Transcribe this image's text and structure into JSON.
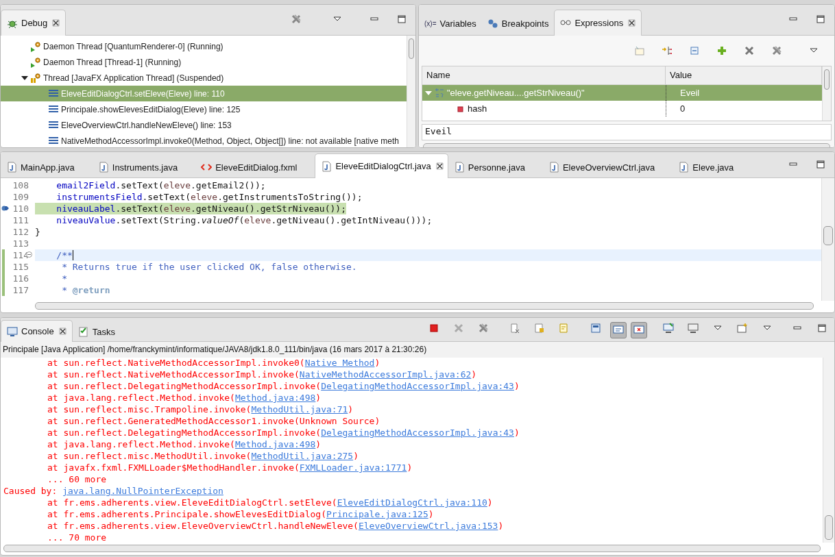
{
  "debug": {
    "tab": {
      "label": "Debug",
      "selected": true
    },
    "tree": [
      {
        "label": "Daemon Thread [QuantumRenderer-0] (Running)",
        "kind": "running",
        "selected": false
      },
      {
        "label": "Daemon Thread [Thread-1] (Running)",
        "kind": "running",
        "selected": false
      },
      {
        "label": "Thread [JavaFX Application Thread] (Suspended)",
        "kind": "suspended",
        "selected": false,
        "expanded": true,
        "children": [
          {
            "label": "EleveEditDialogCtrl.setEleve(Eleve) line: 110",
            "kind": "frame",
            "selected": true
          },
          {
            "label": "Principale.showElevesEditDialog(Eleve) line: 125",
            "kind": "frame",
            "selected": false
          },
          {
            "label": "EleveOverviewCtrl.handleNewEleve() line: 153",
            "kind": "frame",
            "selected": false
          },
          {
            "label": "NativeMethodAccessorImpl.invoke0(Method, Object, Object[]) line: not available [native meth",
            "kind": "frame",
            "selected": false
          }
        ]
      }
    ]
  },
  "expressions": {
    "tabs": [
      {
        "label": "Variables",
        "icon_text": "(x)=",
        "kind": "variables",
        "selected": false
      },
      {
        "label": "Breakpoints",
        "kind": "breakpoints",
        "selected": false
      },
      {
        "label": "Expressions",
        "kind": "expressions",
        "selected": true
      }
    ],
    "columns": [
      "Name",
      "Value"
    ],
    "rows": [
      {
        "name": "\"eleve.getNiveau....getStrNiveau()\"",
        "value": "Eveil",
        "kind": "expression",
        "selected": true,
        "expanded": true,
        "children": [
          {
            "name": "hash",
            "value": "0",
            "kind": "field",
            "selected": false
          }
        ]
      }
    ],
    "detail": "Eveil"
  },
  "editor": {
    "tabs": [
      {
        "label": "MainApp.java",
        "kind": "java",
        "selected": false
      },
      {
        "label": "Instruments.java",
        "kind": "java",
        "selected": false
      },
      {
        "label": "EleveEditDialog.fxml",
        "kind": "xml",
        "selected": false
      },
      {
        "label": "EleveEditDialogCtrl.java",
        "kind": "java",
        "selected": true
      },
      {
        "label": "Personne.java",
        "kind": "java",
        "selected": false
      },
      {
        "label": "EleveOverviewCtrl.java",
        "kind": "java",
        "selected": false
      },
      {
        "label": "Eleve.java",
        "kind": "java",
        "selected": false
      }
    ],
    "lines": [
      {
        "number": "108",
        "current": false,
        "caret": false,
        "changed": false,
        "tokens": [
          {
            "t": "    email2Field",
            "kind": "field"
          },
          {
            "t": ".setText(",
            "kind": "plain"
          },
          {
            "t": "eleve",
            "kind": "param"
          },
          {
            "t": ".getEmail2());",
            "kind": "plain"
          }
        ]
      },
      {
        "number": "109",
        "current": false,
        "caret": false,
        "changed": false,
        "tokens": [
          {
            "t": "    instrumentsField",
            "kind": "field"
          },
          {
            "t": ".setText(",
            "kind": "plain"
          },
          {
            "t": "eleve",
            "kind": "param"
          },
          {
            "t": ".getInstrumentsToString());",
            "kind": "plain"
          }
        ]
      },
      {
        "number": "110",
        "current": true,
        "caret": false,
        "changed": false,
        "tokens": [
          {
            "t": "    niveauLabel",
            "kind": "field"
          },
          {
            "t": ".setText(",
            "kind": "plain"
          },
          {
            "t": "eleve",
            "kind": "param"
          },
          {
            "t": ".getNiveau().getStrNiveau());",
            "kind": "plain"
          }
        ]
      },
      {
        "number": "111",
        "current": false,
        "caret": false,
        "changed": false,
        "tokens": [
          {
            "t": "    niveauValue",
            "kind": "field"
          },
          {
            "t": ".setText(String.",
            "kind": "plain"
          },
          {
            "t": "valueOf",
            "kind": "static"
          },
          {
            "t": "(",
            "kind": "plain"
          },
          {
            "t": "eleve",
            "kind": "param"
          },
          {
            "t": ".getNiveau().getIntNiveau()));",
            "kind": "plain"
          }
        ]
      },
      {
        "number": "112",
        "current": false,
        "caret": false,
        "changed": false,
        "tokens": [
          {
            "t": "}",
            "kind": "plain"
          }
        ]
      },
      {
        "number": "113",
        "current": false,
        "caret": false,
        "changed": false
      },
      {
        "number": "114",
        "current": false,
        "caret": true,
        "changed": true,
        "fold": true,
        "tokens": [
          {
            "t": "    /**",
            "kind": "doc"
          }
        ]
      },
      {
        "number": "115",
        "current": false,
        "caret": false,
        "changed": true,
        "tokens": [
          {
            "t": "     * Returns true if the user clicked OK, false otherwise.",
            "kind": "doc"
          }
        ]
      },
      {
        "number": "116",
        "current": false,
        "caret": false,
        "changed": true,
        "tokens": [
          {
            "t": "     *",
            "kind": "doc"
          }
        ]
      },
      {
        "number": "117",
        "current": false,
        "caret": false,
        "changed": true,
        "tokens": [
          {
            "t": "     * ",
            "kind": "doc"
          },
          {
            "t": "@return",
            "kind": "doctag"
          }
        ]
      }
    ]
  },
  "console": {
    "tabs": [
      {
        "label": "Console",
        "kind": "console",
        "selected": true
      },
      {
        "label": "Tasks",
        "kind": "tasks",
        "selected": false
      }
    ],
    "toggles": [
      {
        "pressed": true
      },
      {
        "pressed": true
      }
    ],
    "process": "Principale [Java Application] /home/franckymint/informatique/JAVA8/jdk1.8.0_111/bin/java (16 mars 2017 à 21:30:26)",
    "lines": [
      {
        "kind": "frame",
        "text": "at sun.reflect.NativeMethodAccessorImpl.invoke0(",
        "link": "Native Method",
        "after": ")"
      },
      {
        "kind": "frame",
        "text": "at sun.reflect.NativeMethodAccessorImpl.invoke(",
        "link": "NativeMethodAccessorImpl.java:62",
        "after": ")"
      },
      {
        "kind": "frame",
        "text": "at sun.reflect.DelegatingMethodAccessorImpl.invoke(",
        "link": "DelegatingMethodAccessorImpl.java:43",
        "after": ")"
      },
      {
        "kind": "frame",
        "text": "at java.lang.reflect.Method.invoke(",
        "link": "Method.java:498",
        "after": ")"
      },
      {
        "kind": "frame",
        "text": "at sun.reflect.misc.Trampoline.invoke(",
        "link": "MethodUtil.java:71",
        "after": ")"
      },
      {
        "kind": "frame",
        "text": "at sun.reflect.GeneratedMethodAccessor1.invoke(Unknown Source)"
      },
      {
        "kind": "frame",
        "text": "at sun.reflect.DelegatingMethodAccessorImpl.invoke(",
        "link": "DelegatingMethodAccessorImpl.java:43",
        "after": ")"
      },
      {
        "kind": "frame",
        "text": "at java.lang.reflect.Method.invoke(",
        "link": "Method.java:498",
        "after": ")"
      },
      {
        "kind": "frame",
        "text": "at sun.reflect.misc.MethodUtil.invoke(",
        "link": "MethodUtil.java:275",
        "after": ")"
      },
      {
        "kind": "frame",
        "text": "at javafx.fxml.FXMLLoader$MethodHandler.invoke(",
        "link": "FXMLLoader.java:1771",
        "after": ")"
      },
      {
        "kind": "frame",
        "text": "... 60 more"
      },
      {
        "kind": "cause",
        "text": "Caused by: ",
        "link": "java.lang.NullPointerException"
      },
      {
        "kind": "frame",
        "text": "at fr.ems.adherents.view.EleveEditDialogCtrl.setEleve(",
        "link": "EleveEditDialogCtrl.java:110",
        "after": ")"
      },
      {
        "kind": "frame",
        "text": "at fr.ems.adherents.Principale.showElevesEditDialog(",
        "link": "Principale.java:125",
        "after": ")"
      },
      {
        "kind": "frame",
        "text": "at fr.ems.adherents.view.EleveOverviewCtrl.handleNewEleve(",
        "link": "EleveOverviewCtrl.java:153",
        "after": ")"
      },
      {
        "kind": "frame",
        "text": "... 70 more"
      }
    ]
  }
}
